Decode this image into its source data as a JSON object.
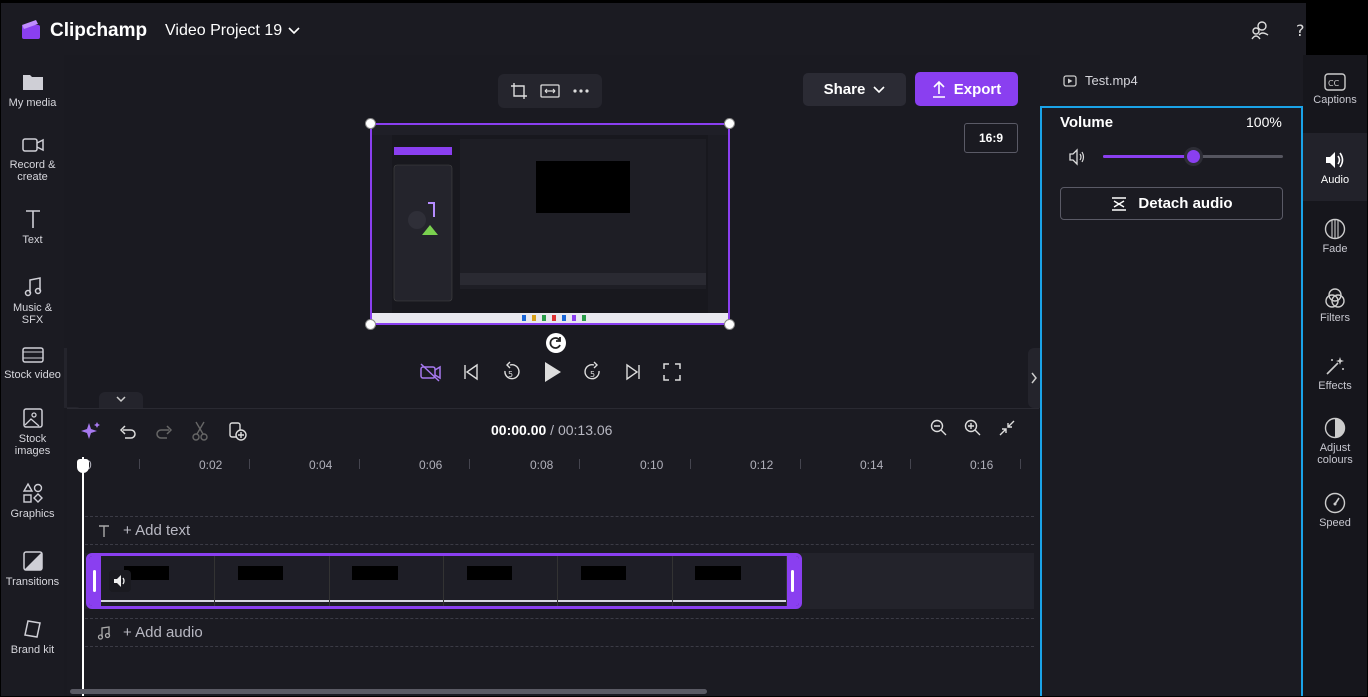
{
  "app": {
    "name": "Clipchamp",
    "project_name": "Video Project 19"
  },
  "left_sidebar": {
    "items": [
      {
        "label": "My media",
        "icon": "folder-icon"
      },
      {
        "label": "Record & create",
        "icon": "camera-icon"
      },
      {
        "label": "Text",
        "icon": "text-icon"
      },
      {
        "label": "Music & SFX",
        "icon": "music-icon"
      },
      {
        "label": "Stock video",
        "icon": "film-icon"
      },
      {
        "label": "Stock images",
        "icon": "image-icon"
      },
      {
        "label": "Graphics",
        "icon": "shapes-icon"
      },
      {
        "label": "Transitions",
        "icon": "transition-icon"
      },
      {
        "label": "Brand kit",
        "icon": "brand-kit-icon"
      }
    ]
  },
  "preview": {
    "share_label": "Share",
    "export_label": "Export",
    "aspect_ratio": "16:9"
  },
  "timeline": {
    "current_time": "00:00.00",
    "total_time": "/ 00:13.06",
    "ruler_labels": [
      "0",
      "0:02",
      "0:04",
      "0:06",
      "0:08",
      "0:10",
      "0:12",
      "0:14",
      "0:16"
    ],
    "add_text_label": "+ Add text",
    "add_audio_label": "+ Add audio"
  },
  "properties": {
    "file_name": "Test.mp4",
    "volume_label": "Volume",
    "volume_value": "100%",
    "volume_level": 0.5,
    "detach_audio_label": "Detach audio"
  },
  "right_rail": {
    "items": [
      {
        "label": "Captions",
        "icon": "captions-icon",
        "active": false
      },
      {
        "label": "Audio",
        "icon": "speaker-icon",
        "active": true
      },
      {
        "label": "Fade",
        "icon": "fade-icon",
        "active": false
      },
      {
        "label": "Filters",
        "icon": "filters-icon",
        "active": false
      },
      {
        "label": "Effects",
        "icon": "effects-icon",
        "active": false
      },
      {
        "label": "Adjust colours",
        "icon": "adjust-colours-icon",
        "active": false
      },
      {
        "label": "Speed",
        "icon": "speed-icon",
        "active": false
      }
    ]
  },
  "colors": {
    "accent": "#8a3ff0",
    "selection_outline": "#1aa3e8",
    "background": "#1a1a21"
  }
}
